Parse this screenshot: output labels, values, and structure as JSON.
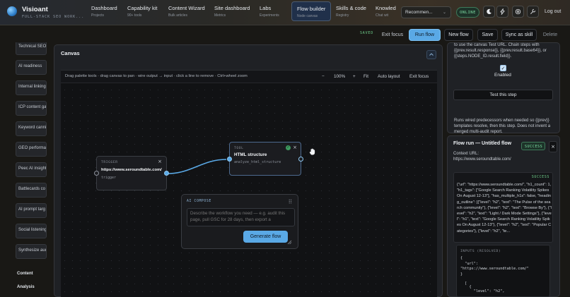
{
  "brand": {
    "name": "Visioant",
    "tagline": "FULL-STACK SEO WORK..."
  },
  "nav": [
    {
      "label": "Dashboard",
      "sub": "Projects"
    },
    {
      "label": "Capability kit",
      "sub": "90+ tools"
    },
    {
      "label": "Content Wizard",
      "sub": "Bulk articles"
    },
    {
      "label": "Site dashboard",
      "sub": "Metrics"
    },
    {
      "label": "Labs",
      "sub": "Experiments"
    },
    {
      "label": "Flow builder",
      "sub": "Node canvas"
    },
    {
      "label": "Skills & code",
      "sub": "Registry"
    },
    {
      "label": "Knowled",
      "sub": "Chat wit"
    }
  ],
  "header": {
    "select_value": "Recommen...",
    "status": "ONLINE",
    "logout": "Log out"
  },
  "toolbar": {
    "saved": "SAVED",
    "exit_focus": "Exit focus",
    "run_flow": "Run flow",
    "new_flow": "New flow",
    "save": "Save",
    "sync_skill": "Sync as skill",
    "delete": "Delete"
  },
  "sidebar": {
    "items": [
      "Technical SEO",
      "AI readiness",
      "Internal linking",
      "ICP content ga",
      "Keyword canni",
      "GEO performa",
      "Peec AI insight",
      "Battlecards co",
      "AI prompt targ",
      "Social listening",
      "Synthesize aud"
    ],
    "sections": [
      "Content",
      "Analysis"
    ]
  },
  "canvas": {
    "title": "Canvas",
    "hint": "Drag palette tools · drag canvas to pan · wire output → input · click a line to remove · Ctrl+wheel zoom",
    "zoom_minus": "−",
    "zoom": "100%",
    "zoom_plus": "+",
    "fit": "Fit",
    "auto_layout": "Auto layout",
    "exit_focus": "Exit focus",
    "trigger": {
      "label": "TRIGGER",
      "title": "https://www.seroundtable.com/",
      "sub": "trigger",
      "close": "×"
    },
    "tool": {
      "label": "TOOL",
      "title": "HTML structure",
      "sub": "analyze_html_structure",
      "close": "×"
    },
    "compose": {
      "label": "AI COMPOSE",
      "placeholder": "Describe the workflow you need — e.g. audit this page, pull GSC for 28 days, then export a",
      "button": "Generate flow"
    }
  },
  "right_panel": {
    "help_text": "to use the canvas Test URL. Chain steps with {{prev.result.response}}, {{prev.result.base64}}, or {{steps.NODE_ID.result.field}}.",
    "enabled_label": "Enabled",
    "test_button": "Test this step",
    "note": "Runs wired predecessors when needed so {{prev}} templates resolve, then this step. Does not invent a merged multi-audit report."
  },
  "run": {
    "title": "Flow run — Untitled flow",
    "status": "SUCCESS",
    "context_label": "Context URL:",
    "context_url": "https://www.seroundtable.com/",
    "result_status": "SUCCESS",
    "result_json": "{\"url\": \"https://www.seroundtable.com/\", \"h1_count\": 1, \"h1_tags\": [\"Google Search Ranking Volatility Spikes On August 12-13\"], \"has_multiple_h1s\": false, \"heading_outline\": [{\"level\": \"h2\", \"text\": \"The Pulse of the search community\"}, {\"level\": \"h2\", \"text\": \"Browse By\"}, {\"level\": \"h2\", \"text\": \"Light / Dark Mode Settings\"}, {\"level\": \"h1\", \"text\": \"Google Search Ranking Volatility Spikes On August 12-13\"}, {\"level\": \"h2\", \"text\": \"Popular Categories\"}, {\"level\": \"h2\", \"te...",
    "inputs_label": "INPUTS (RESOLVED)",
    "inputs_lines": [
      "{",
      "  \"url\":",
      "\"https://www.seroundtable.com/\"",
      "}"
    ],
    "bottom_lines": [
      "  [",
      "    {",
      "      \"level\": \"h2\","
    ]
  },
  "colors": {
    "accent": "#5aa9e6",
    "success": "#6fcf8b",
    "node_border": "#4a5a70"
  }
}
